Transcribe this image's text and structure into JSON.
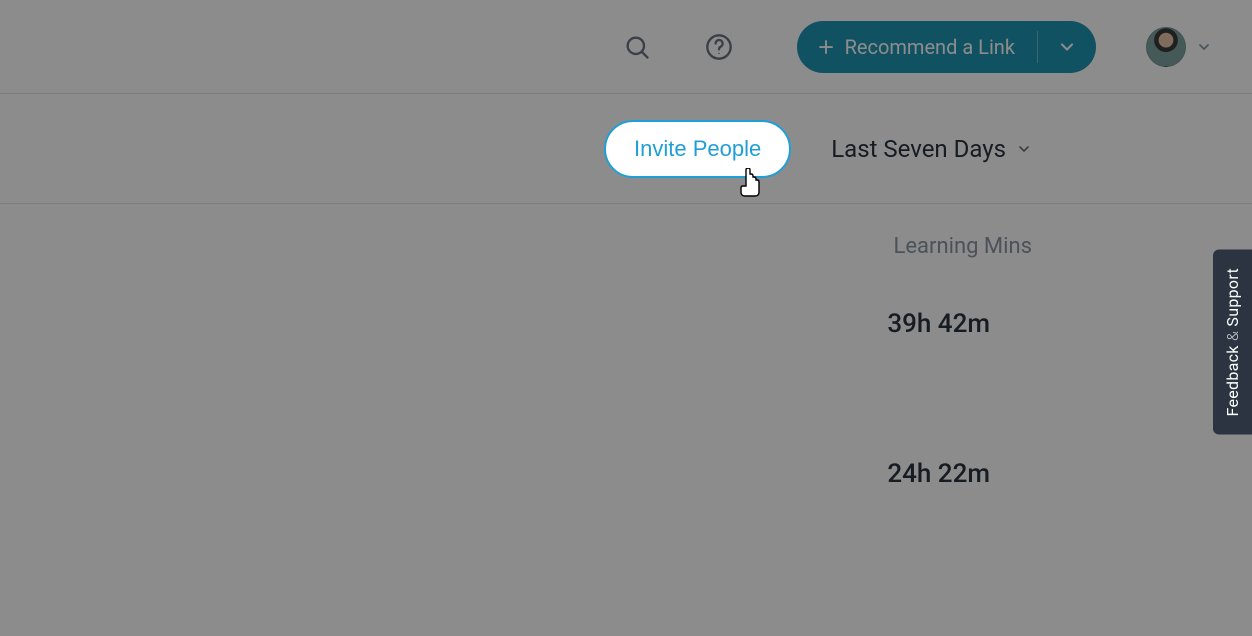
{
  "header": {
    "recommend_label": "Recommend a Link"
  },
  "subheader": {
    "invite_label": "Invite People",
    "date_filter_label": "Last Seven Days"
  },
  "content": {
    "column_header": "Learning Mins",
    "rows": [
      {
        "value": "39h 42m"
      },
      {
        "value": "24h 22m"
      }
    ]
  },
  "feedback": {
    "text_a": "Feedback",
    "amp": "&",
    "text_b": "Support"
  }
}
